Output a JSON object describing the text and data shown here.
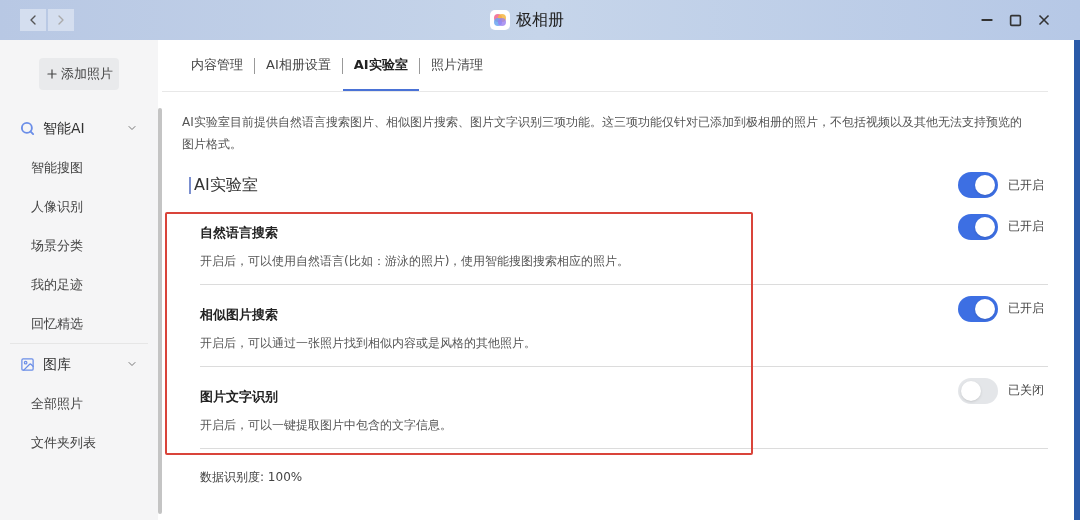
{
  "window": {
    "title": "极相册"
  },
  "add_button": "添加照片",
  "sidebar": {
    "groups": [
      {
        "label": "智能AI",
        "kind": "search",
        "expanded": true,
        "items": [
          {
            "label": "智能搜图"
          },
          {
            "label": "人像识别"
          },
          {
            "label": "场景分类"
          },
          {
            "label": "我的足迹"
          },
          {
            "label": "回忆精选"
          }
        ]
      },
      {
        "label": "图库",
        "kind": "image",
        "expanded": true,
        "items": [
          {
            "label": "全部照片"
          },
          {
            "label": "文件夹列表"
          }
        ]
      }
    ]
  },
  "tabs": [
    {
      "label": "内容管理",
      "selected": false
    },
    {
      "label": "AI相册设置",
      "selected": false
    },
    {
      "label": "AI实验室",
      "selected": true
    },
    {
      "label": "照片清理",
      "selected": false
    }
  ],
  "intro": "AI实验室目前提供自然语言搜索图片、相似图片搜索、图片文字识别三项功能。这三项功能仅针对已添加到极相册的照片，不包括视频以及其他无法支持预览的图片格式。",
  "section": {
    "title": "AI实验室",
    "on": true,
    "status": "已开启"
  },
  "features": [
    {
      "title": "自然语言搜索",
      "description": "开启后，可以使用自然语言(比如：游泳的照片)，使用智能搜图搜索相应的照片。",
      "on": true,
      "status": "已开启"
    },
    {
      "title": "相似图片搜索",
      "description": "开启后，可以通过一张照片找到相似内容或是风格的其他照片。",
      "on": true,
      "status": "已开启"
    },
    {
      "title": "图片文字识别",
      "description": "开启后，可以一键提取图片中包含的文字信息。",
      "on": false,
      "status": "已关闭"
    }
  ],
  "accuracy": "数据识别度: 100%"
}
